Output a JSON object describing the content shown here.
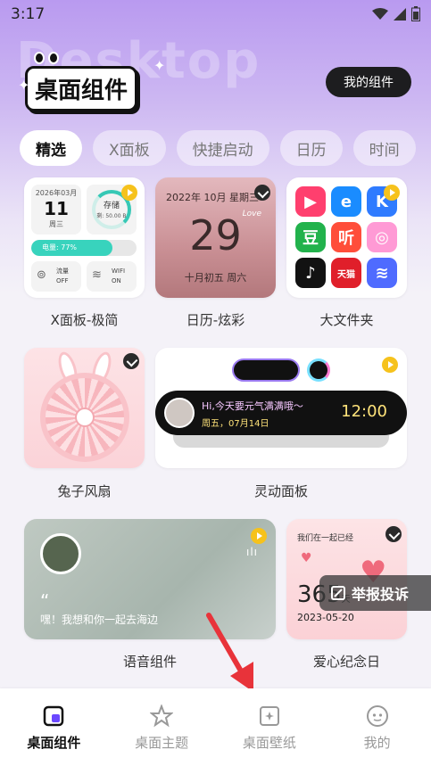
{
  "status_bar": {
    "time": "3:17"
  },
  "header": {
    "ghost_text": "Desktop",
    "title": "桌面组件",
    "my_widgets_button": "我的组件"
  },
  "tabs": [
    {
      "label": "精选",
      "active": true
    },
    {
      "label": "X面板",
      "active": false
    },
    {
      "label": "快捷启动",
      "active": false
    },
    {
      "label": "日历",
      "active": false
    },
    {
      "label": "时间",
      "active": false
    }
  ],
  "widgets": {
    "x_panel": {
      "label": "X面板-极简",
      "cal_month": "2026年03月",
      "cal_day": "11",
      "cal_weekday": "周三",
      "storage_title": "存储",
      "storage_value": "剩: 50.00 B",
      "battery_text": "电量: 77%",
      "battery_level": 0.77,
      "data_label": "流量",
      "data_state": "OFF",
      "wifi_label": "WIFI",
      "wifi_state": "ON"
    },
    "calendar": {
      "label": "日历-炫彩",
      "top_line": "2022年 10月 星期三",
      "day": "29",
      "lunar": "十月初五 周六",
      "script_text": "Love"
    },
    "folder": {
      "label": "大文件夹",
      "apps": [
        {
          "name": "快影",
          "glyph": "▶",
          "color": "#ff3f6e"
        },
        {
          "name": "饿了么",
          "glyph": "e",
          "color": "#1a8cff"
        },
        {
          "name": "K",
          "glyph": "K",
          "color": "#2f7bff"
        },
        {
          "name": "豆瓣",
          "glyph": "豆",
          "color": "#22b24c"
        },
        {
          "name": "听",
          "glyph": "听",
          "color": "#ff4e3a"
        },
        {
          "name": "圆环",
          "glyph": "◎",
          "color": "#ff9ad5"
        },
        {
          "name": "抖音",
          "glyph": "♪",
          "color": "#121212"
        },
        {
          "name": "天猫",
          "glyph": "天猫",
          "color": "#e01f2a"
        },
        {
          "name": "旋涡",
          "glyph": "≋",
          "color": "#4f6bff"
        }
      ]
    },
    "rabbit_fan": {
      "label": "兔子风扇"
    },
    "dynamic_island": {
      "label": "灵动面板",
      "message": "Hi,今天要元气满满哦～",
      "date": "周五，07月14日",
      "clock": "12:00"
    },
    "voice": {
      "label": "语音组件",
      "quote_mark": "“",
      "text": "嘿！我想和你一起去海边"
    },
    "love": {
      "label": "爱心纪念日",
      "title": "我们在一起已经",
      "days": "365",
      "days_unit": "天",
      "date": "2023-05-20"
    }
  },
  "report_button": "举报投诉",
  "bottom_nav": [
    {
      "label": "桌面组件",
      "icon": "widget-icon",
      "active": true
    },
    {
      "label": "桌面主题",
      "icon": "star-icon",
      "active": false
    },
    {
      "label": "桌面壁纸",
      "icon": "wallpaper-icon",
      "active": false
    },
    {
      "label": "我的",
      "icon": "profile-icon",
      "active": false
    }
  ],
  "colors": {
    "accent": "#6b48ff",
    "report_bg": "#3c3c3c",
    "arrow": "#e8333a"
  }
}
